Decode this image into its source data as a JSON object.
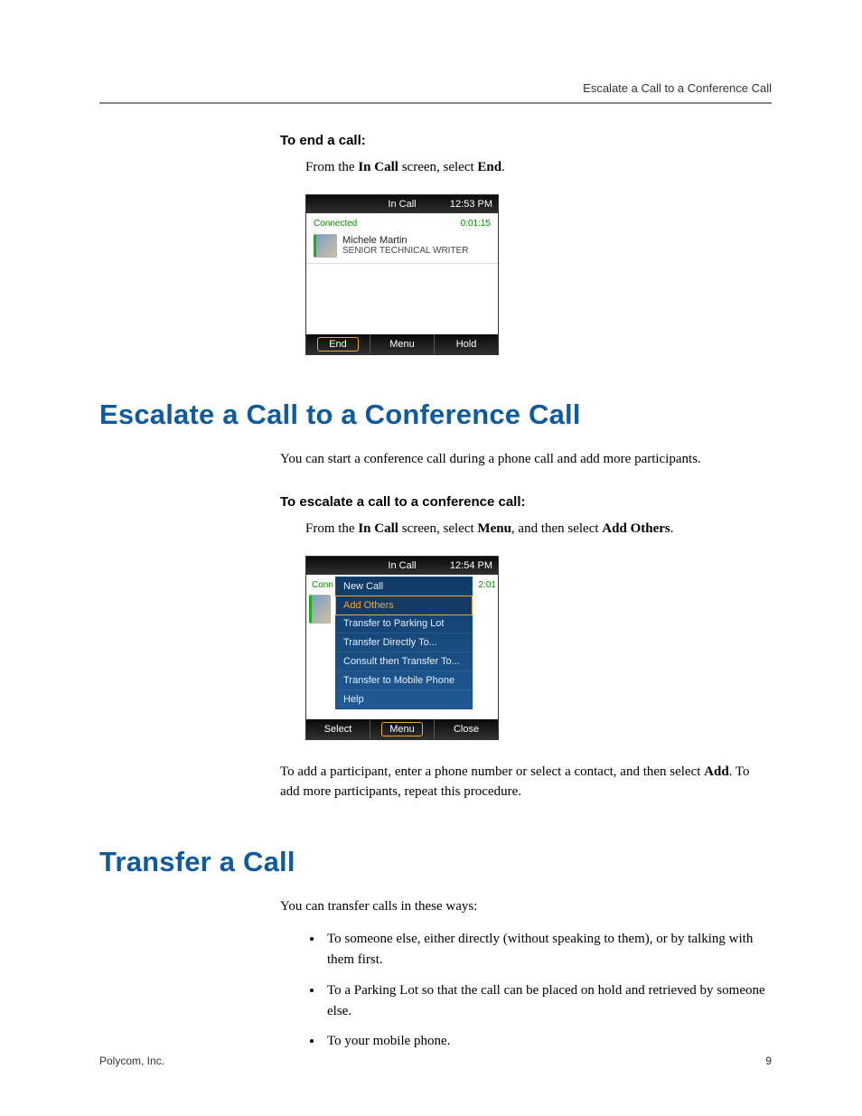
{
  "header": {
    "running": "Escalate a Call to a Conference Call"
  },
  "s1": {
    "task": "To end a call:",
    "body_pre": "From the ",
    "body_b1": "In Call",
    "body_mid": " screen, select ",
    "body_b2": "End",
    "body_post": "."
  },
  "shot1": {
    "title": "In Call",
    "time": "12:53 PM",
    "status": "Connected",
    "timer": "0:01:15",
    "name": "Michele Martin",
    "role": "SENIOR TECHNICAL WRITER",
    "sk1": "End",
    "sk2": "Menu",
    "sk3": "Hold"
  },
  "h1a": "Escalate a Call to a Conference Call",
  "s2": {
    "intro": "You can start a conference call during a phone call and add more participants.",
    "task": "To escalate a call to a conference call:",
    "body_pre": "From the ",
    "body_b1": "In Call",
    "body_mid1": " screen, select ",
    "body_b2": "Menu",
    "body_mid2": ", and then select ",
    "body_b3": "Add Others",
    "body_post": "."
  },
  "shot2": {
    "title": "In Call",
    "time": "12:54 PM",
    "status": "Conn",
    "timer": "2:01",
    "menu": {
      "i0": "New Call",
      "i1": "Add Others",
      "i2": "Transfer to Parking Lot",
      "i3": "Transfer Directly To...",
      "i4": "Consult then Transfer To...",
      "i5": "Transfer to Mobile Phone",
      "i6": "Help"
    },
    "sk1": "Select",
    "sk2": "Menu",
    "sk3": "Close"
  },
  "s3": {
    "p_pre": "To add a participant, enter a phone number or select a contact, and then select ",
    "p_b": "Add",
    "p_post": ". To add more participants, repeat this procedure."
  },
  "h1b": "Transfer a Call",
  "s4": {
    "intro": "You can transfer calls in these ways:",
    "b1": "To someone else, either directly (without speaking to them), or by talking with them first.",
    "b2": "To a Parking Lot so that the call can be placed on hold and retrieved by someone else.",
    "b3": "To your mobile phone."
  },
  "footer": {
    "left": "Polycom, Inc.",
    "right": "9"
  }
}
